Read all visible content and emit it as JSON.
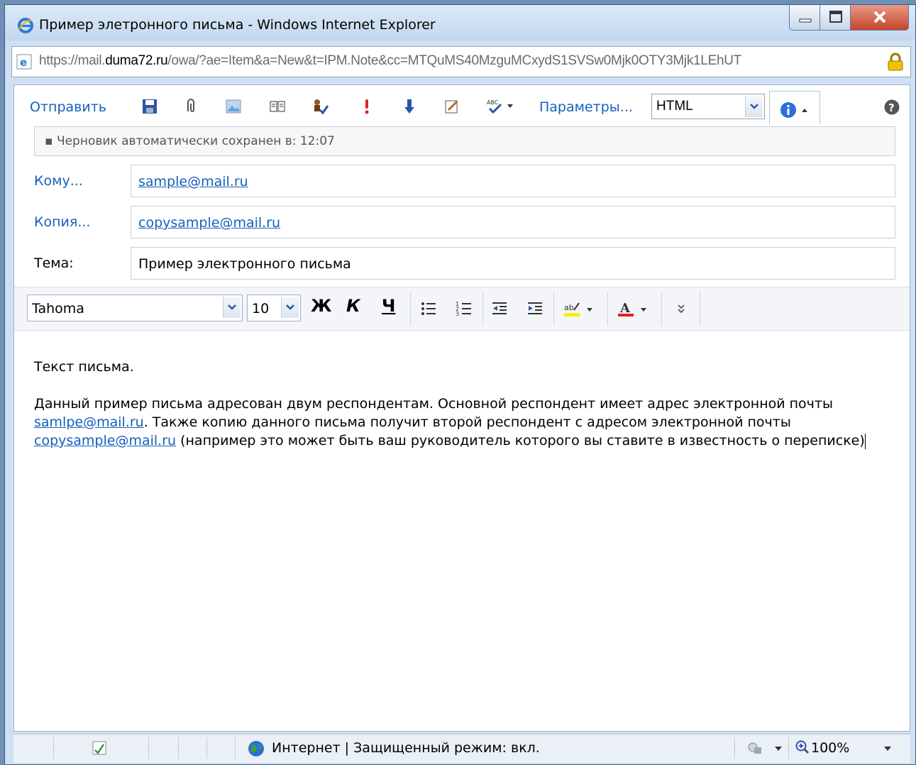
{
  "window": {
    "title": "Пример элетронного письма - Windows Internet Explorer"
  },
  "address_bar": {
    "url_scheme": "https://",
    "url_sub": "mail.",
    "url_domain": "duma72.ru",
    "url_path": "/owa/?ae=Item&a=New&t=IPM.Note&cc=MTQuMS40MzguMCxydS1SVSw0Mjk0OTY3Mjk1LEhUT"
  },
  "toolbar": {
    "send_label": "Отправить",
    "params_label": "Параметры...",
    "format_value": "HTML"
  },
  "draft_notice": "Черновик автоматически сохранен в: 12:07",
  "fields": {
    "to_label": "Кому...",
    "to_value": "sample@mail.ru",
    "cc_label": "Копия...",
    "cc_value": "copysample@mail.ru",
    "subject_label": "Тема:",
    "subject_value": "Пример электронного письма"
  },
  "format_bar": {
    "font_name": "Tahoma",
    "font_size": "10",
    "bold_label": "Ж",
    "italic_label": "К",
    "underline_label": "Ч"
  },
  "message": {
    "line1": "Текст письма.",
    "p2_part1": "Данный пример письма адресован двум респондентам. Основной респондент имеет адрес электронной почты",
    "p2_link1": "samlpe@mail.ru",
    "p2_part2": ". Также копию данного письма получит второй респондент с адресом электронной почты",
    "p2_link2": "copysample@mail.ru",
    "p2_part3": " (например это может быть ваш руководитель которого вы ставите в известность о переписке)"
  },
  "status_bar": {
    "zone_text": "Интернет | Защищенный режим: вкл.",
    "zoom_text": "100%"
  }
}
